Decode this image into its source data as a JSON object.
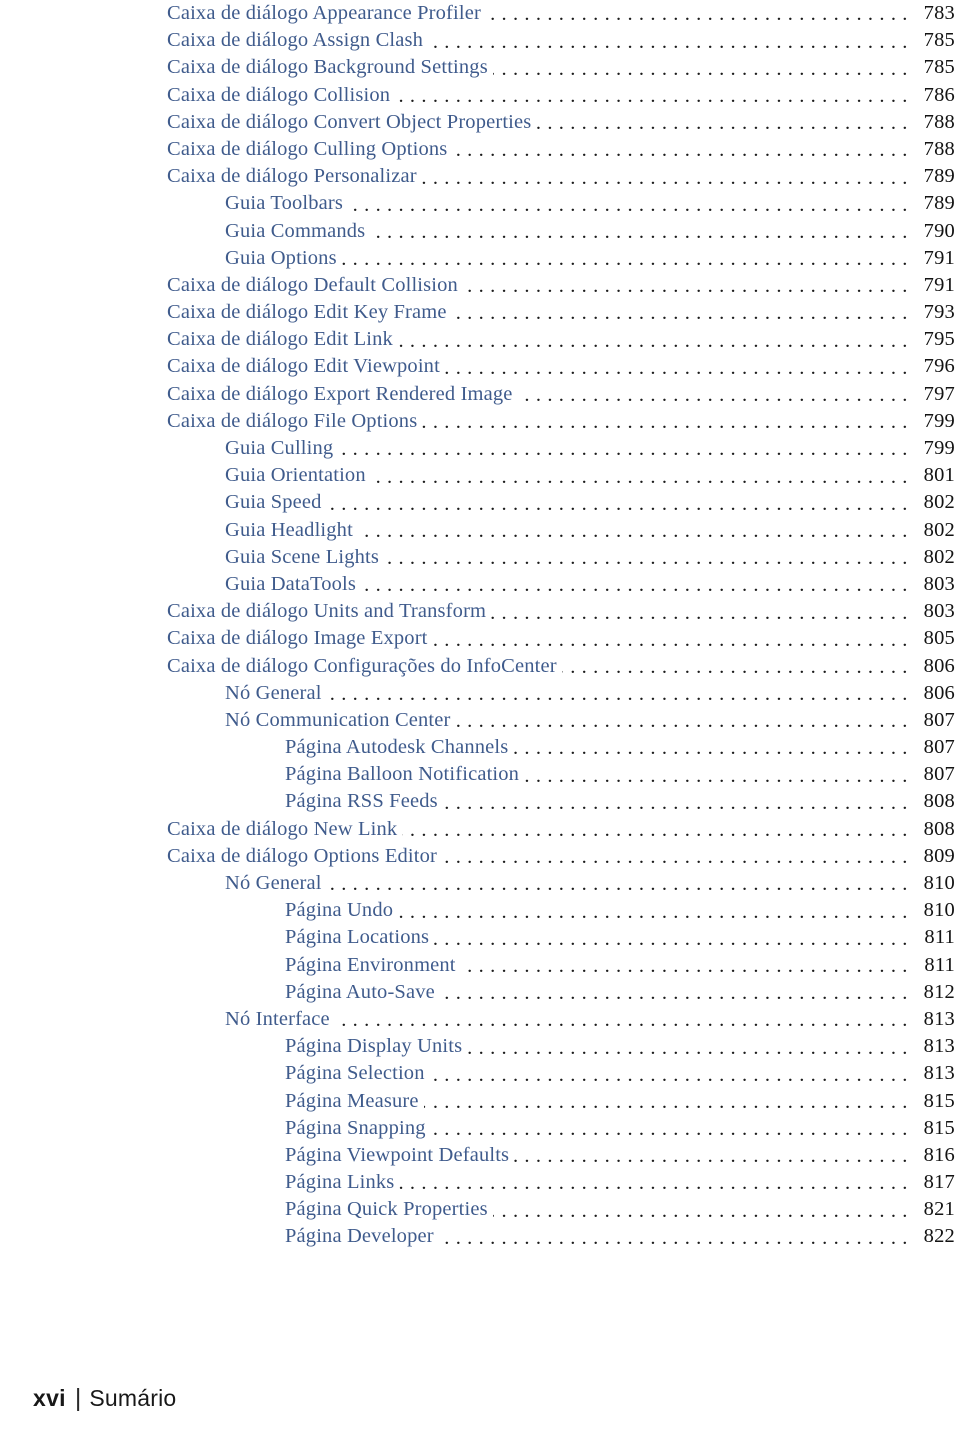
{
  "document": {
    "type": "table-of-contents",
    "language": "pt-BR",
    "text_color": "#3f5b8c",
    "page_number_color": "#131313",
    "leader_color": "#1b1b1b"
  },
  "toc": {
    "entries": [
      {
        "level": 0,
        "title": "Caixa de diálogo Appearance Profiler",
        "page": "783"
      },
      {
        "level": 0,
        "title": "Caixa de diálogo Assign Clash",
        "page": "785"
      },
      {
        "level": 0,
        "title": "Caixa de diálogo Background Settings",
        "page": "785"
      },
      {
        "level": 0,
        "title": "Caixa de diálogo Collision",
        "page": "786"
      },
      {
        "level": 0,
        "title": "Caixa de diálogo Convert Object Properties",
        "page": "788"
      },
      {
        "level": 0,
        "title": "Caixa de diálogo Culling Options",
        "page": "788"
      },
      {
        "level": 0,
        "title": "Caixa de diálogo Personalizar",
        "page": "789"
      },
      {
        "level": 1,
        "title": "Guia Toolbars",
        "page": "789"
      },
      {
        "level": 1,
        "title": "Guia Commands",
        "page": "790"
      },
      {
        "level": 1,
        "title": "Guia Options",
        "page": "791"
      },
      {
        "level": 0,
        "title": "Caixa de diálogo Default Collision",
        "page": "791"
      },
      {
        "level": 0,
        "title": "Caixa de diálogo Edit Key Frame",
        "page": "793"
      },
      {
        "level": 0,
        "title": "Caixa de diálogo Edit Link",
        "page": "795"
      },
      {
        "level": 0,
        "title": "Caixa de diálogo Edit Viewpoint",
        "page": "796"
      },
      {
        "level": 0,
        "title": "Caixa de diálogo Export Rendered Image",
        "page": "797"
      },
      {
        "level": 0,
        "title": "Caixa de diálogo File Options",
        "page": "799"
      },
      {
        "level": 1,
        "title": "Guia Culling",
        "page": "799"
      },
      {
        "level": 1,
        "title": "Guia Orientation",
        "page": "801"
      },
      {
        "level": 1,
        "title": "Guia Speed",
        "page": "802"
      },
      {
        "level": 1,
        "title": "Guia Headlight",
        "page": "802"
      },
      {
        "level": 1,
        "title": "Guia Scene Lights",
        "page": "802"
      },
      {
        "level": 1,
        "title": "Guia DataTools",
        "page": "803"
      },
      {
        "level": 0,
        "title": "Caixa de diálogo Units and Transform",
        "page": "803"
      },
      {
        "level": 0,
        "title": "Caixa de diálogo Image Export",
        "page": "805"
      },
      {
        "level": 0,
        "title": "Caixa de diálogo Configurações do InfoCenter",
        "page": "806"
      },
      {
        "level": 1,
        "title": "Nó General",
        "page": "806"
      },
      {
        "level": 1,
        "title": "Nó Communication Center",
        "page": "807"
      },
      {
        "level": 2,
        "title": "Página Autodesk Channels",
        "page": "807"
      },
      {
        "level": 2,
        "title": "Página Balloon Notification",
        "page": "807"
      },
      {
        "level": 2,
        "title": "Página RSS Feeds",
        "page": "808"
      },
      {
        "level": 0,
        "title": "Caixa de diálogo New Link",
        "page": "808"
      },
      {
        "level": 0,
        "title": "Caixa de diálogo Options Editor",
        "page": "809"
      },
      {
        "level": 1,
        "title": "Nó General",
        "page": "810"
      },
      {
        "level": 2,
        "title": "Página Undo",
        "page": "810"
      },
      {
        "level": 2,
        "title": "Página Locations",
        "page": "811"
      },
      {
        "level": 2,
        "title": "Página Environment",
        "page": "811"
      },
      {
        "level": 2,
        "title": "Página Auto-Save",
        "page": "812"
      },
      {
        "level": 1,
        "title": "Nó Interface",
        "page": "813"
      },
      {
        "level": 2,
        "title": "Página Display Units",
        "page": "813"
      },
      {
        "level": 2,
        "title": "Página Selection",
        "page": "813"
      },
      {
        "level": 2,
        "title": "Página Measure",
        "page": "815"
      },
      {
        "level": 2,
        "title": "Página Snapping",
        "page": "815"
      },
      {
        "level": 2,
        "title": "Página Viewpoint Defaults",
        "page": "816"
      },
      {
        "level": 2,
        "title": "Página Links",
        "page": "817"
      },
      {
        "level": 2,
        "title": "Página Quick Properties",
        "page": "821"
      },
      {
        "level": 2,
        "title": "Página Developer",
        "page": "822"
      }
    ]
  },
  "footer": {
    "folio": "xvi",
    "separator": "|",
    "section_name": "Sumário"
  }
}
